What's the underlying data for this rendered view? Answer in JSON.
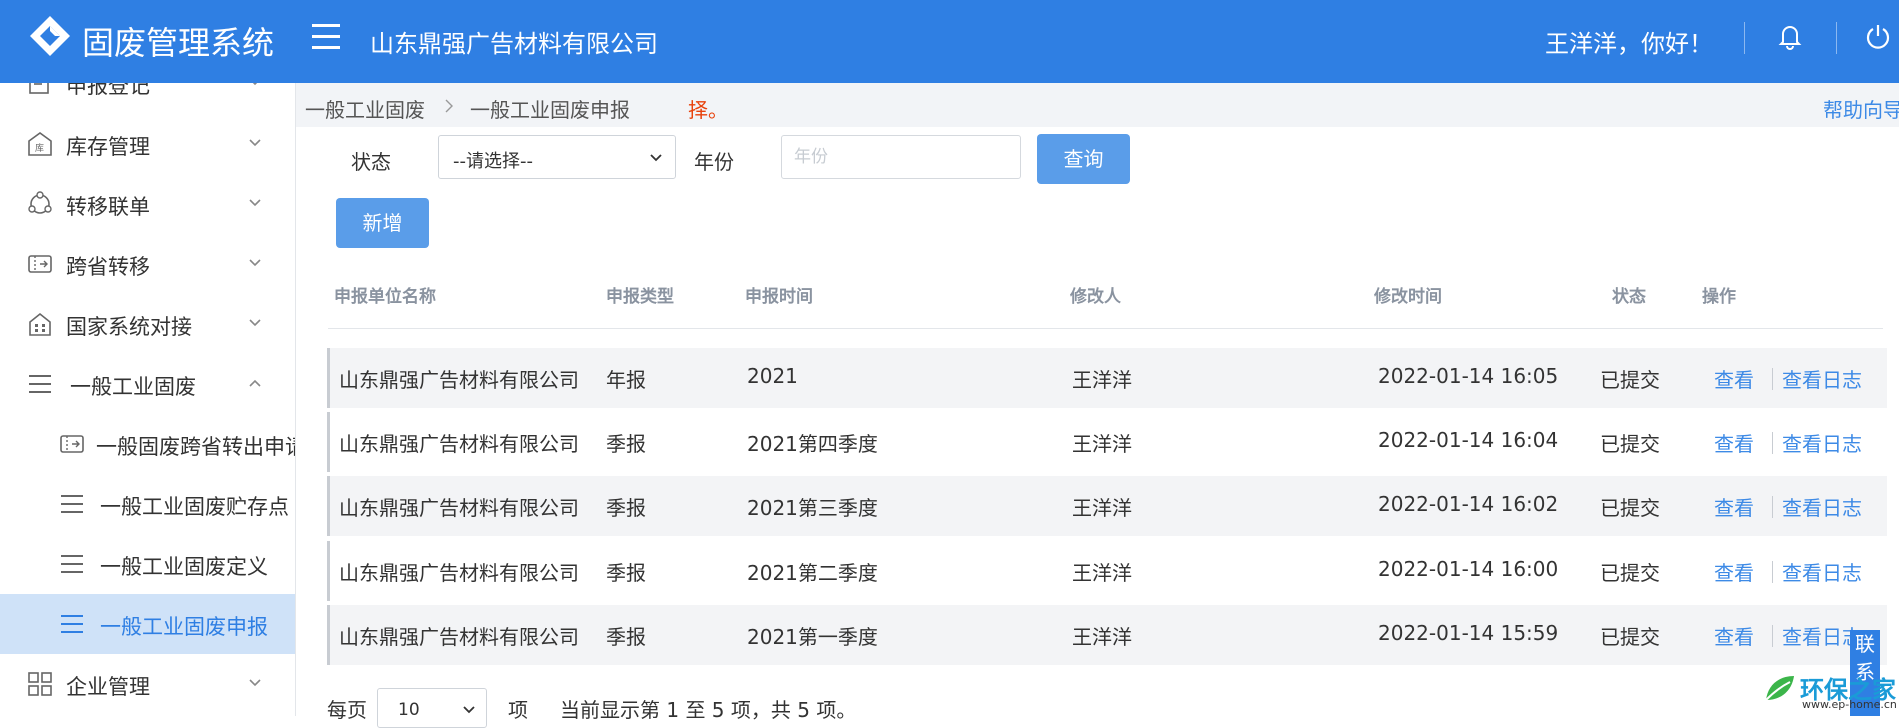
{
  "header": {
    "app_title": "固废管理系统",
    "company": "山东鼎强广告材料有限公司",
    "greeting": "王洋洋，你好！"
  },
  "sidebar": {
    "items": [
      {
        "label": "申报登记",
        "icon": "form-icon"
      },
      {
        "label": "库存管理",
        "icon": "warehouse-icon"
      },
      {
        "label": "转移联单",
        "icon": "transfer-icon"
      },
      {
        "label": "跨省转移",
        "icon": "ticket-icon"
      },
      {
        "label": "国家系统对接",
        "icon": "building-icon"
      },
      {
        "label": "一般工业固废",
        "icon": "list-icon"
      },
      {
        "label": "一般固废跨省转出申请",
        "icon": "ticket-icon"
      },
      {
        "label": "一般工业固废贮存点",
        "icon": "list-icon"
      },
      {
        "label": "一般工业固废定义",
        "icon": "list-icon"
      },
      {
        "label": "一般工业固废申报",
        "icon": "list-icon"
      },
      {
        "label": "企业管理",
        "icon": "grid-icon"
      }
    ]
  },
  "breadcrumb": {
    "items": [
      "一般工业固废",
      "一般工业固废申报"
    ],
    "notice": "择。",
    "help": "帮助向导"
  },
  "filters": {
    "status_label": "状态",
    "status_value": "--请选择--",
    "year_label": "年份",
    "year_placeholder": "年份",
    "query_button": "查询",
    "add_button": "新增"
  },
  "table": {
    "columns": [
      "申报单位名称",
      "申报类型",
      "申报时间",
      "修改人",
      "修改时间",
      "状态",
      "操作"
    ],
    "rows": [
      {
        "unit": "山东鼎强广告材料有限公司",
        "type": "年报",
        "period": "2021",
        "modifier": "王洋洋",
        "modified": "2022-01-14 16:05",
        "status": "已提交",
        "view": "查看",
        "log": "查看日志"
      },
      {
        "unit": "山东鼎强广告材料有限公司",
        "type": "季报",
        "period": "2021第四季度",
        "modifier": "王洋洋",
        "modified": "2022-01-14 16:04",
        "status": "已提交",
        "view": "查看",
        "log": "查看日志"
      },
      {
        "unit": "山东鼎强广告材料有限公司",
        "type": "季报",
        "period": "2021第三季度",
        "modifier": "王洋洋",
        "modified": "2022-01-14 16:02",
        "status": "已提交",
        "view": "查看",
        "log": "查看日志"
      },
      {
        "unit": "山东鼎强广告材料有限公司",
        "type": "季报",
        "period": "2021第二季度",
        "modifier": "王洋洋",
        "modified": "2022-01-14 16:00",
        "status": "已提交",
        "view": "查看",
        "log": "查看日志"
      },
      {
        "unit": "山东鼎强广告材料有限公司",
        "type": "季报",
        "period": "2021第一季度",
        "modifier": "王洋洋",
        "modified": "2022-01-14 15:59",
        "status": "已提交",
        "view": "查看",
        "log": "查看日志"
      }
    ]
  },
  "pagination": {
    "per_page_label": "每页",
    "per_page_value": "10",
    "unit_label": "项",
    "summary": "当前显示第 1 至 5 项，共 5 项。"
  },
  "contact": {
    "label": "联系"
  },
  "watermark": {
    "text": "环保之家",
    "url": "www.ep-home.cn"
  },
  "colors": {
    "header": "#2f7fe3",
    "accent": "#3d8ae6",
    "active_bg": "#cfe2f8",
    "notice": "#e8420c"
  }
}
